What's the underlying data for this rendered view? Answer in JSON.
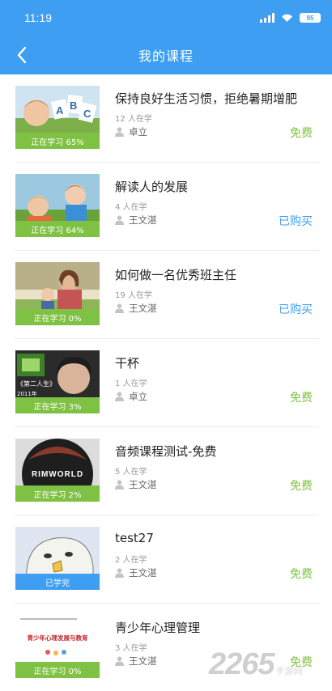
{
  "status_bar": {
    "time": "11:19",
    "battery": "95"
  },
  "header": {
    "title": "我的课程"
  },
  "colors": {
    "header_bg": "#3d9ef2",
    "free": "#7fc142",
    "purchased": "#3d9ef2",
    "progress_bg": "#7fc142",
    "done_bg": "#3d9ef2"
  },
  "courses": [
    {
      "title": "保持良好生活习惯，拒绝暑期增肥",
      "learners": "12 人在学",
      "author": "卓立",
      "price": "免费",
      "progress": "正在学习 65%",
      "progress_value": 65
    },
    {
      "title": "解读人的发展",
      "learners": "4 人在学",
      "author": "王文湛",
      "price": "已购买",
      "progress": "正在学习 64%",
      "progress_value": 64
    },
    {
      "title": "如何做一名优秀班主任",
      "learners": "19 人在学",
      "author": "王文湛",
      "price": "已购买",
      "progress": "正在学习 0%",
      "progress_value": 0
    },
    {
      "title": "干杯",
      "learners": "1 人在学",
      "author": "卓立",
      "price": "免费",
      "progress": "正在学习 3%",
      "progress_value": 3,
      "thumb_text": "《第二人生》",
      "thumb_year": "2011年"
    },
    {
      "title": "音频课程测试-免费",
      "learners": "5 人在学",
      "author": "王文湛",
      "price": "免费",
      "progress": "正在学习 2%",
      "progress_value": 2,
      "thumb_text": "RIMWORLD"
    },
    {
      "title": "test27",
      "learners": "2 人在学",
      "author": "王文湛",
      "price": "免费",
      "progress": "已学完",
      "progress_value": 100
    },
    {
      "title": "青少年心理管理",
      "learners": "3 人在学",
      "author": "王文湛",
      "price": "免费",
      "progress": "正在学习 0%",
      "progress_value": 0,
      "thumb_text": "青少年心理发展与教育"
    }
  ],
  "watermark": {
    "number": "2265",
    "suffix": "手游网"
  }
}
